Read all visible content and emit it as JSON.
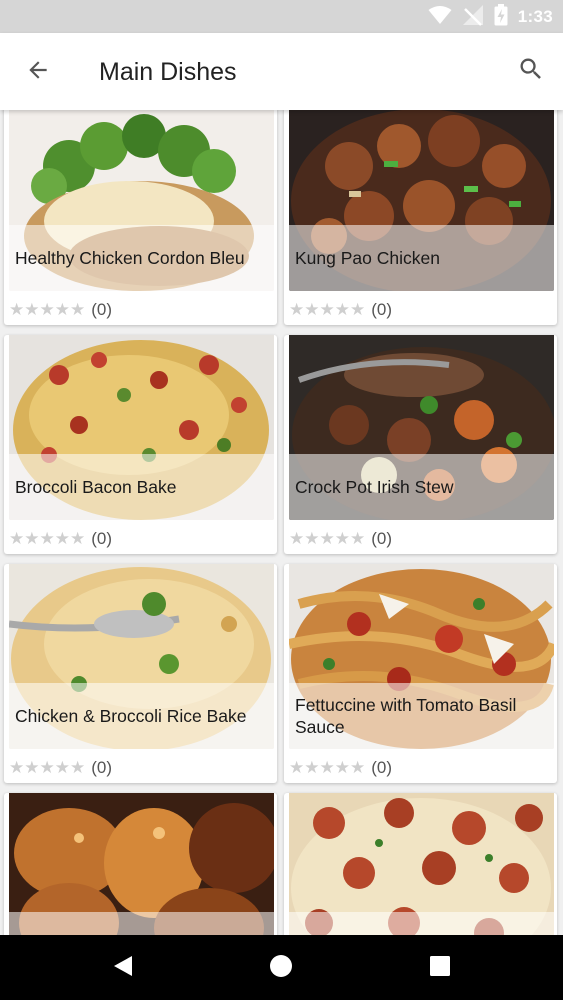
{
  "status_bar": {
    "time": "1:33",
    "icons": [
      "wifi-icon",
      "no-signal-icon",
      "battery-charging-icon"
    ]
  },
  "app_bar": {
    "title": "Main Dishes",
    "back_icon": "arrow-left-icon",
    "search_icon": "search-icon"
  },
  "recipes": [
    {
      "title": "Healthy Chicken Cordon Bleu",
      "stars": "★★★★★",
      "rating_count": "(0)",
      "image": "chicken-cordon-bleu-photo"
    },
    {
      "title": "Kung Pao Chicken",
      "stars": "★★★★★",
      "rating_count": "(0)",
      "image": "kung-pao-chicken-photo"
    },
    {
      "title": "Broccoli Bacon Bake",
      "stars": "★★★★★",
      "rating_count": "(0)",
      "image": "broccoli-bacon-bake-photo"
    },
    {
      "title": "Crock Pot Irish Stew",
      "stars": "★★★★★",
      "rating_count": "(0)",
      "image": "irish-stew-photo"
    },
    {
      "title": "Chicken & Broccoli Rice Bake",
      "stars": "★★★★★",
      "rating_count": "(0)",
      "image": "chicken-broccoli-rice-bake-photo"
    },
    {
      "title": "Fettuccine with Tomato Basil Sauce",
      "stars": "★★★★★",
      "rating_count": "(0)",
      "image": "fettuccine-photo"
    },
    {
      "title": "",
      "image": "glazed-chicken-photo"
    },
    {
      "title": "",
      "image": "pepperoni-pasta-bake-photo"
    }
  ],
  "nav_bar": {
    "icons": [
      "back-triangle-icon",
      "home-circle-icon",
      "recents-square-icon"
    ]
  }
}
